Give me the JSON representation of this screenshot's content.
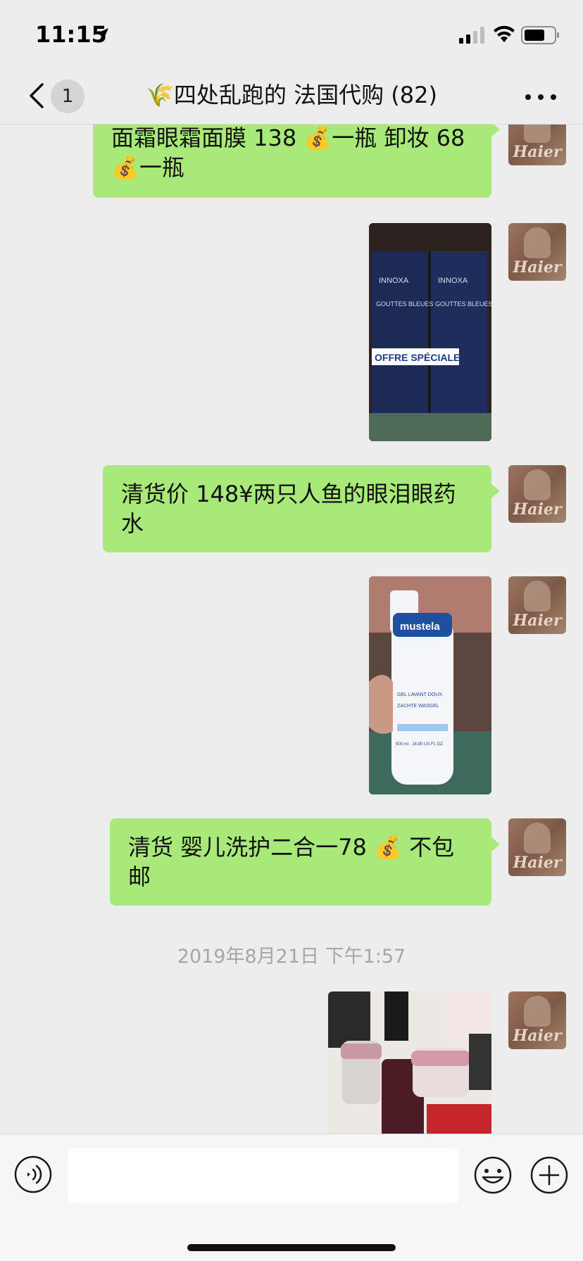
{
  "status_bar": {
    "time": "11:15"
  },
  "nav": {
    "unread_count": "1",
    "title": "🌾四处乱跑的 法国代购 (82)"
  },
  "avatar_label": "Haier",
  "messages": {
    "m1": "面霜眼霜面膜 138 💰一瓶 卸妆 68 💰一瓶",
    "photo1": {
      "brand": "INNOXA",
      "product": "GOUTTES BLEUES",
      "badge": "OFFRE SPÉCIALE"
    },
    "m2": "清货价 148¥两只人鱼的眼泪眼药水",
    "photo2": {
      "brand": "mustela",
      "line1": "GEL LAVANT DOUX",
      "line2": "ZACHTE WASGEL",
      "volume": "500 ml · 16.90 US FL OZ"
    },
    "m3": "清货 婴儿洗护二合一78 💰 不包邮",
    "timestamp": "2019年8月21日 下午1:57"
  },
  "input": {
    "value": "",
    "placeholder": ""
  }
}
